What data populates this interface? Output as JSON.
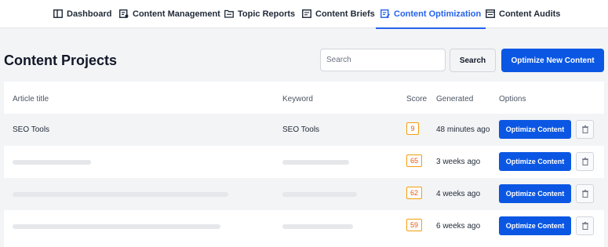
{
  "nav": {
    "tabs": [
      {
        "label": "Dashboard",
        "icon": "dashboard-icon"
      },
      {
        "label": "Content Management",
        "icon": "content-management-icon"
      },
      {
        "label": "Topic Reports",
        "icon": "folder-icon"
      },
      {
        "label": "Content Briefs",
        "icon": "brief-icon"
      },
      {
        "label": "Content Optimization",
        "icon": "optimization-icon",
        "active": true
      },
      {
        "label": "Content Audits",
        "icon": "audit-icon"
      }
    ]
  },
  "page": {
    "title": "Content Projects",
    "search_placeholder": "Search",
    "search_button": "Search",
    "primary_button": "Optimize New Content"
  },
  "table": {
    "headers": {
      "title": "Article title",
      "keyword": "Keyword",
      "score": "Score",
      "generated": "Generated",
      "options": "Options"
    },
    "rows": [
      {
        "title": "SEO Tools",
        "keyword": "SEO Tools",
        "score": "9",
        "generated": "48 minutes ago",
        "action": "Optimize Content",
        "blurred": false
      },
      {
        "title": "",
        "keyword": "",
        "score": "65",
        "generated": "3 weeks ago",
        "action": "Optimize Content",
        "blurred": true
      },
      {
        "title": "",
        "keyword": "",
        "score": "62",
        "generated": "4 weeks ago",
        "action": "Optimize Content",
        "blurred": true
      },
      {
        "title": "",
        "keyword": "",
        "score": "59",
        "generated": "6 weeks ago",
        "action": "Optimize Content",
        "blurred": true
      }
    ]
  },
  "colors": {
    "accent": "#0b57e3",
    "active_tab": "#2563eb",
    "score_border": "#f59e0b",
    "score_text": "#ea580c"
  }
}
